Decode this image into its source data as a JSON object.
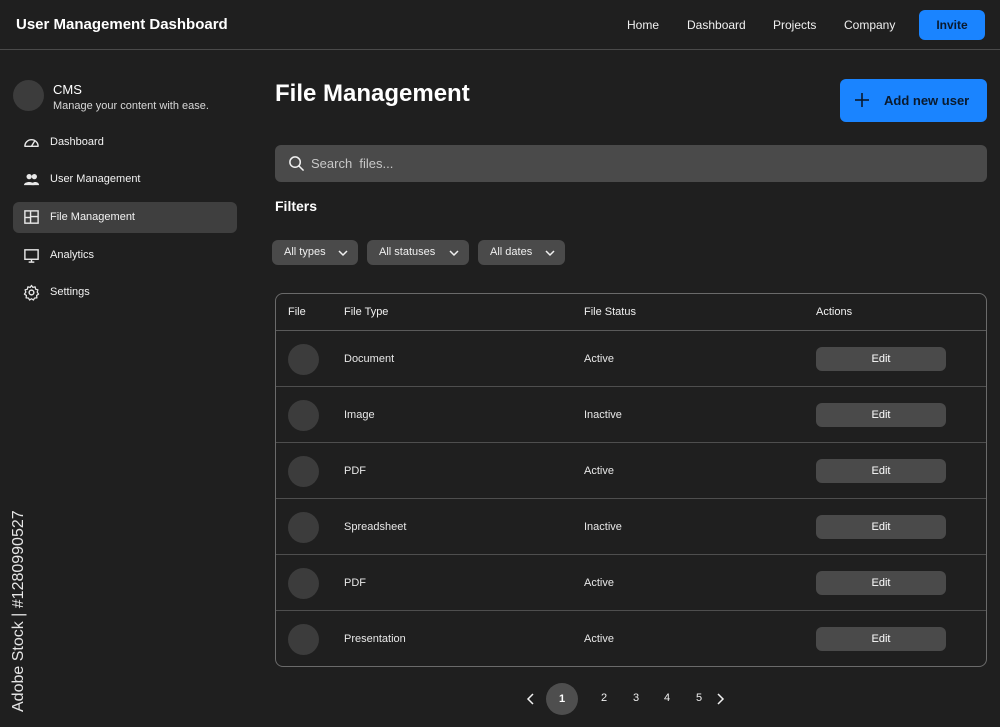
{
  "header": {
    "title": "User Management Dashboard",
    "nav": [
      "Home",
      "Dashboard",
      "Projects",
      "Company"
    ],
    "invite_label": "Invite"
  },
  "sidebar": {
    "brand_name": "CMS",
    "brand_tagline": "Manage your content with ease.",
    "items": [
      {
        "label": "Dashboard",
        "icon": "gauge-icon"
      },
      {
        "label": "User Management",
        "icon": "users-icon"
      },
      {
        "label": "File Management",
        "icon": "layout-icon",
        "active": true
      },
      {
        "label": "Analytics",
        "icon": "monitor-icon"
      },
      {
        "label": "Settings",
        "icon": "gear-icon"
      }
    ]
  },
  "main": {
    "title": "File Management",
    "add_button_label": "Add new user",
    "search_placeholder": "Search  files...",
    "filters_title": "Filters",
    "filters": [
      "All types",
      "All statuses",
      "All dates"
    ],
    "table": {
      "headers": [
        "File",
        "File Type",
        "File Status",
        "Actions"
      ],
      "rows": [
        {
          "type": "Document",
          "status": "Active",
          "action": "Edit"
        },
        {
          "type": "Image",
          "status": "Inactive",
          "action": "Edit"
        },
        {
          "type": "PDF",
          "status": "Active",
          "action": "Edit"
        },
        {
          "type": "Spreadsheet",
          "status": "Inactive",
          "action": "Edit"
        },
        {
          "type": "PDF",
          "status": "Active",
          "action": "Edit"
        },
        {
          "type": "Presentation",
          "status": "Active",
          "action": "Edit"
        }
      ]
    },
    "pagination": {
      "current": "1",
      "pages": [
        "2",
        "3",
        "4",
        "5"
      ]
    }
  },
  "watermark": {
    "text": "Adobe Stock | #1280990527"
  },
  "colors": {
    "background": "#1f1f1f",
    "accent": "#1a84ff",
    "surface": "#4a4a4a"
  }
}
